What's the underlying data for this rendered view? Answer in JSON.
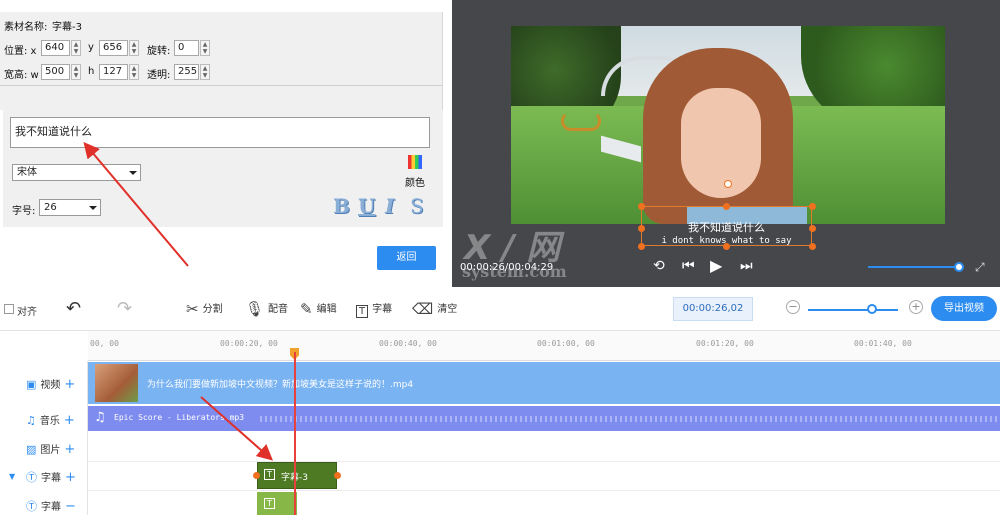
{
  "props": {
    "material_name_label": "素材名称:",
    "material_name_value": "字幕-3",
    "pos_label": "位置: x",
    "x_value": "640",
    "y_label": "y",
    "y_value": "656",
    "rotate_label": "旋转:",
    "rotate_value": "0",
    "size_label": "宽高: w",
    "w_value": "500",
    "h_label": "h",
    "h_value": "127",
    "opacity_label": "透明:",
    "opacity_value": "255",
    "text_value": "我不知道说什么",
    "font_value": "宋体",
    "color_label": "颜色",
    "fontsize_label": "字号:",
    "fontsize_value": "26",
    "bold": "B",
    "underline": "U",
    "italic": "I",
    "strike": "S",
    "back_label": "返回"
  },
  "preview": {
    "subtitle_cn": "我不知道说什么",
    "subtitle_en": "i dont knows what to say",
    "time": "00:00:26/00:04:29",
    "watermark": "X / 网",
    "watermark_sub": "system.com",
    "volume_fraction": 0.95
  },
  "toolbar": {
    "align_label": "对齐",
    "split_label": "分割",
    "dub_label": "配音",
    "edit_label": "编辑",
    "subtitle_label": "字幕",
    "clear_label": "清空",
    "time_value": "00:00:26,02",
    "zoom_minus": "−",
    "zoom_plus": "+",
    "export_label": "导出视频"
  },
  "timeline": {
    "ticks": [
      "00, 00",
      "00:00:20, 00",
      "00:00:40, 00",
      "00:01:00, 00",
      "00:01:20, 00",
      "00:01:40, 00"
    ],
    "tracks": [
      {
        "label": "视频",
        "action": "+"
      },
      {
        "label": "音乐",
        "action": "+"
      },
      {
        "label": "图片",
        "action": "+"
      },
      {
        "label": "字幕",
        "action": "+"
      },
      {
        "label": "字幕",
        "action": "−"
      }
    ],
    "video_clip_name": "为什么我们要做新加坡中文视频？新加坡美女是这样子说的！.mp4",
    "audio_clip_name": "Epic Score - Liberators.mp3",
    "subtitle_clip_name": "字幕-3"
  },
  "colors": {
    "accent": "#2d8cf0",
    "video_track": "#7ab3f2",
    "audio_track": "#7e8cf0",
    "subtitle_clip": "#4d7a23",
    "playhead": "#e8403a",
    "annotation_arrow": "#e0302a"
  }
}
